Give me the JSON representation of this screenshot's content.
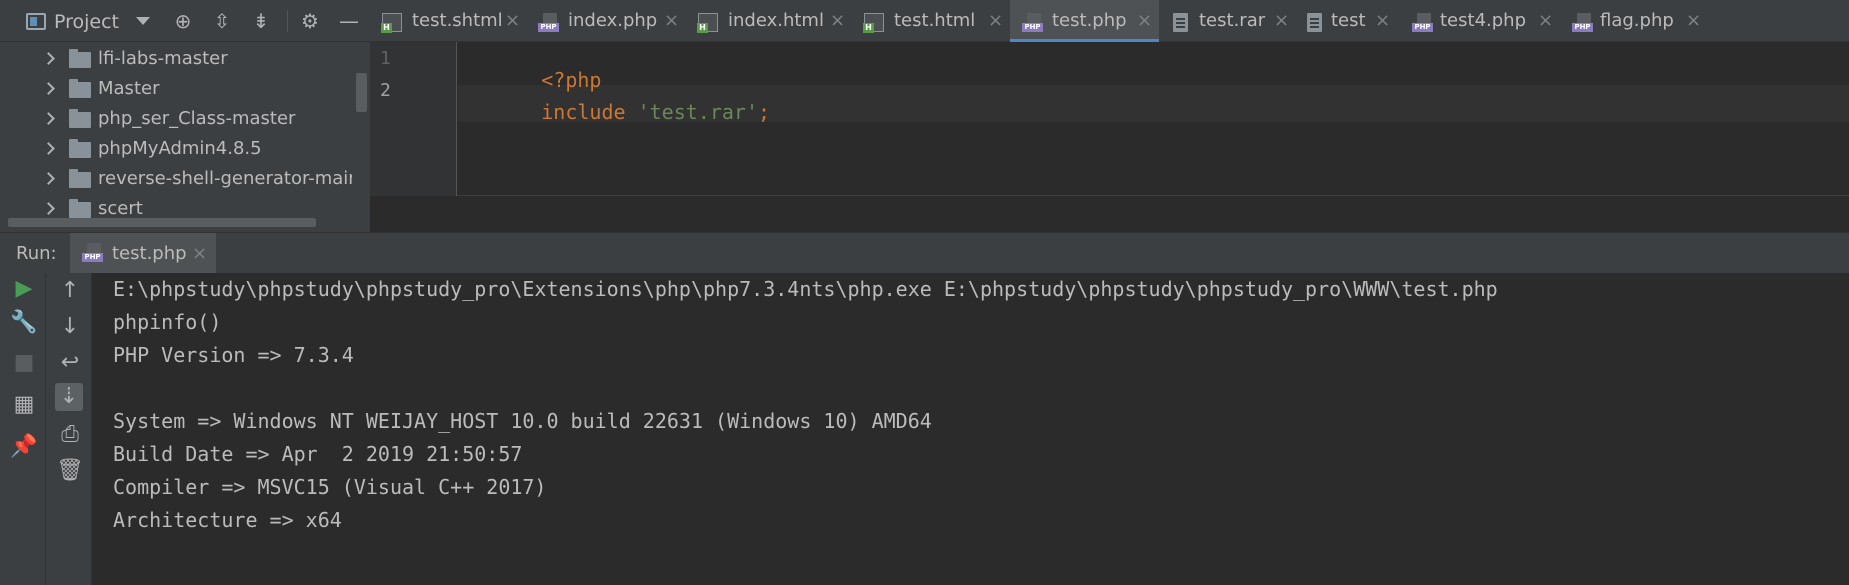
{
  "project": {
    "title": "Project",
    "toolbar_icons": [
      "target-icon",
      "expand-all-icon",
      "collapse-all-icon",
      "gear-icon",
      "hide-icon"
    ],
    "tree": [
      {
        "label": "lfi-labs-master"
      },
      {
        "label": "Master"
      },
      {
        "label": "php_ser_Class-master"
      },
      {
        "label": "phpMyAdmin4.8.5"
      },
      {
        "label": "reverse-shell-generator-main"
      },
      {
        "label": "scert"
      }
    ]
  },
  "tabs": [
    {
      "label": "test.shtml",
      "type": "html"
    },
    {
      "label": "index.php",
      "type": "php"
    },
    {
      "label": "index.html",
      "type": "html"
    },
    {
      "label": "test.html",
      "type": "html"
    },
    {
      "label": "test.php",
      "type": "php",
      "active": true
    },
    {
      "label": "test.rar",
      "type": "text"
    },
    {
      "label": "test",
      "type": "text"
    },
    {
      "label": "test4.php",
      "type": "php"
    },
    {
      "label": "flag.php",
      "type": "php"
    }
  ],
  "tab_close_glyph": "×",
  "editor": {
    "line_numbers": [
      "1",
      "2"
    ],
    "line1": {
      "kw": "<?php"
    },
    "line2": {
      "kw": "include",
      "space": " ",
      "str": "'test.rar'",
      "end": ";"
    }
  },
  "run": {
    "label": "Run:",
    "tab_label": "test.php",
    "output": [
      "E:\\phpstudy\\phpstudy\\phpstudy_pro\\Extensions\\php\\php7.3.4nts\\php.exe E:\\phpstudy\\phpstudy\\phpstudy_pro\\WWW\\test.php",
      "phpinfo()",
      "PHP Version => 7.3.4",
      "",
      "System => Windows NT WEIJAY_HOST 10.0 build 22631 (Windows 10) AMD64",
      "Build Date => Apr  2 2019 21:50:57",
      "Compiler => MSVC15 (Visual C++ 2017)",
      "Architecture => x64"
    ]
  },
  "colors": {
    "keyword": "#cc7832",
    "string": "#6a8759",
    "active_tab_underline": "#4a88c7",
    "run_green": "#499c54"
  }
}
